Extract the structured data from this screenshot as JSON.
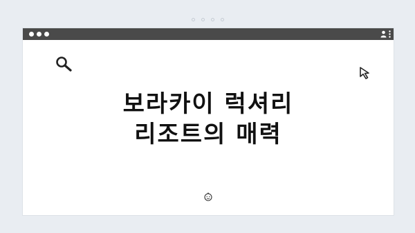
{
  "window": {
    "headline_line1": "보라카이 럭셔리",
    "headline_line2": "리조트의 매력"
  },
  "icons": {
    "search": "search-icon",
    "cursor": "cursor-arrow-icon",
    "user": "user-icon",
    "menu": "kebab-menu-icon",
    "face": "smiley-face-icon"
  },
  "colors": {
    "background": "#e9edf2",
    "titlebar": "#4a4a4a",
    "window": "#ffffff",
    "text": "#111111"
  }
}
